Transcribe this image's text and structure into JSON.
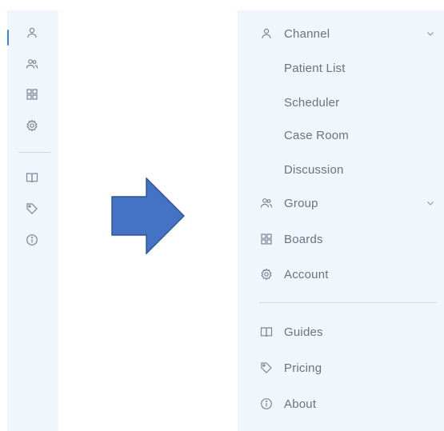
{
  "collapsed_rail": {
    "icons": [
      "user-icon",
      "group-icon",
      "boards-icon",
      "settings-icon",
      "book-icon",
      "tag-icon",
      "info-icon"
    ]
  },
  "arrow": {
    "color": "#4472c4",
    "direction": "right"
  },
  "expanded_menu": {
    "channel": {
      "label": "Channel",
      "icon": "user-icon",
      "expanded": true
    },
    "channel_children": [
      "Patient List",
      "Scheduler",
      "Case Room",
      "Discussion"
    ],
    "group": {
      "label": "Group",
      "icon": "group-icon"
    },
    "boards": {
      "label": "Boards",
      "icon": "boards-icon"
    },
    "account": {
      "label": "Account",
      "icon": "settings-icon"
    },
    "guides": {
      "label": "Guides",
      "icon": "book-icon"
    },
    "pricing": {
      "label": "Pricing",
      "icon": "tag-icon"
    },
    "about": {
      "label": "About",
      "icon": "info-icon"
    }
  },
  "colors": {
    "panel_bg": "#f1f6fc",
    "accent": "#3b82f6",
    "text": "#6b7280"
  }
}
